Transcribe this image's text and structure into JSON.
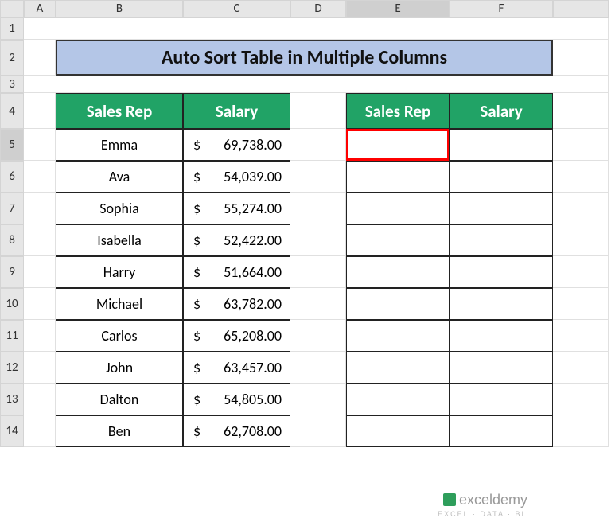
{
  "columns": [
    "",
    "A",
    "B",
    "C",
    "D",
    "E",
    "F",
    ""
  ],
  "rows": [
    "1",
    "2",
    "3",
    "4",
    "5",
    "6",
    "7",
    "8",
    "9",
    "10",
    "11",
    "12",
    "13",
    "14"
  ],
  "selectedCol": 5,
  "selectedRow": 4,
  "title": "Auto Sort Table in Multiple Columns",
  "tableHeaders": {
    "rep": "Sales Rep",
    "sal": "Salary"
  },
  "salaryPrefix": "$",
  "reps": [
    {
      "name": "Emma",
      "salary": "69,738.00"
    },
    {
      "name": "Ava",
      "salary": "54,039.00"
    },
    {
      "name": "Sophia",
      "salary": "55,274.00"
    },
    {
      "name": "Isabella",
      "salary": "52,422.00"
    },
    {
      "name": "Harry",
      "salary": "51,664.00"
    },
    {
      "name": "Michael",
      "salary": "63,782.00"
    },
    {
      "name": "Carlos",
      "salary": "65,208.00"
    },
    {
      "name": "John",
      "salary": "63,457.00"
    },
    {
      "name": "Dalton",
      "salary": "54,805.00"
    },
    {
      "name": "Ben",
      "salary": "62,708.00"
    }
  ],
  "logo": {
    "text": "exceldemy",
    "sub": "EXCEL · DATA · BI"
  },
  "chart_data": {
    "type": "table",
    "title": "Auto Sort Table in Multiple Columns",
    "columns": [
      "Sales Rep",
      "Salary"
    ],
    "rows": [
      [
        "Emma",
        69738.0
      ],
      [
        "Ava",
        54039.0
      ],
      [
        "Sophia",
        55274.0
      ],
      [
        "Isabella",
        52422.0
      ],
      [
        "Harry",
        51664.0
      ],
      [
        "Michael",
        63782.0
      ],
      [
        "Carlos",
        65208.0
      ],
      [
        "John",
        63457.0
      ],
      [
        "Dalton",
        54805.0
      ],
      [
        "Ben",
        62708.0
      ]
    ]
  }
}
